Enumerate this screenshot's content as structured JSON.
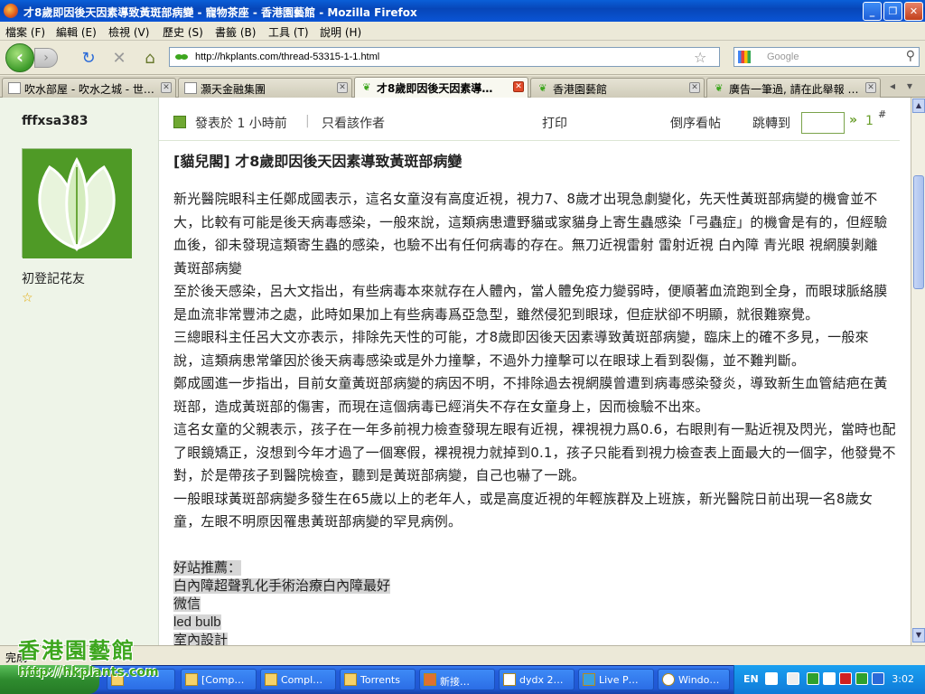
{
  "window": {
    "title": "才8歲即因後天因素導致黃斑部病變 - 寵物茶座 - 香港園藝館 - Mozilla Firefox"
  },
  "menu": [
    "檔案 (F)",
    "編輯 (E)",
    "檢視 (V)",
    "歷史 (S)",
    "書籤 (B)",
    "工具 (T)",
    "說明 (H)"
  ],
  "nav": {
    "url": "http://hkplants.com/thread-53315-1-1.html",
    "search_placeholder": "Google"
  },
  "tabs": [
    {
      "label": "吹水部屋 - 吹水之城 - 世…",
      "active": false
    },
    {
      "label": "灝天金融集團",
      "active": false
    },
    {
      "label": "才8歲即因後天因素導…",
      "active": true
    },
    {
      "label": "香港園藝館",
      "active": false
    },
    {
      "label": "廣告一筆過, 請在此舉報 …",
      "active": false
    }
  ],
  "sidebar": {
    "username": "fffxsa383",
    "user_title": "初登記花友"
  },
  "post": {
    "meta_posted": "發表於 1 小時前",
    "meta_author_only": "只看該作者",
    "print": "打印",
    "reverse": "倒序看帖",
    "goto": "跳轉到",
    "arrow": "»",
    "floor": "1",
    "hash": "#",
    "title": "[貓兒閣] 才8歲即因後天因素導致黃斑部病變",
    "paragraphs": [
      "新光醫院眼科主任鄭成國表示，這名女童沒有高度近視，視力7、8歲才出現急劇變化，先天性黃斑部病變的機會並不大，比較有可能是後天病毒感染，一般來說，這類病患遭野貓或家貓身上寄生蟲感染「弓蟲症」的機會是有的，但經驗血後，卻未發現這類寄生蟲的感染，也驗不出有任何病毒的存在。無刀近視雷射 雷射近視 白內障 青光眼 視網膜剝離 黃斑部病變",
      "至於後天感染，呂大文指出，有些病毒本來就存在人體內，當人體免疫力變弱時，便順著血流跑到全身，而眼球脈絡膜是血流非常豐沛之處，此時如果加上有些病毒爲亞急型，雖然侵犯到眼球，但症狀卻不明顯，就很難察覺。",
      "三總眼科主任呂大文亦表示，排除先天性的可能，才8歲即因後天因素導致黃斑部病變，臨床上的確不多見，一般來說，這類病患常肇因於後天病毒感染或是外力撞擊，不過外力撞擊可以在眼球上看到裂傷，並不難判斷。",
      "鄭成國進一步指出，目前女童黃斑部病變的病因不明，不排除過去視網膜曾遭到病毒感染發炎，導致新生血管結疤在黃斑部，造成黃斑部的傷害，而現在這個病毒已經消失不存在女童身上，因而檢驗不出來。",
      "這名女童的父親表示，孩子在一年多前視力檢查發現左眼有近視，裸視視力爲0.6，右眼則有一點近視及閃光，當時也配了眼鏡矯正，沒想到今年才過了一個寒假，裸視視力就掉到0.1，孩子只能看到視力檢查表上面最大的一個字，他發覺不對，於是帶孩子到醫院檢查，聽到是黃斑部病變，自己也嚇了一跳。",
      "一般眼球黃斑部病變多發生在65歲以上的老年人，或是高度近視的年輕族群及上班族，新光醫院日前出現一名8歲女童，左眼不明原因罹患黃斑部病變的罕見病例。"
    ],
    "recommend_title": "好站推薦：",
    "recommend_links": [
      "白內障超聲乳化手術治療白內障最好",
      "微信",
      "led bulb",
      "室內設計"
    ]
  },
  "status": {
    "text": "完成"
  },
  "watermark": {
    "line1": "香港園藝館",
    "line2": "http://hkplants.com"
  },
  "taskbar": {
    "items": [
      "[Comp…",
      "Compl…",
      "Torrents",
      "新接…",
      "dydx 2…",
      "Live P…",
      "Windo…"
    ],
    "lang": "EN",
    "clock": "3:02"
  }
}
